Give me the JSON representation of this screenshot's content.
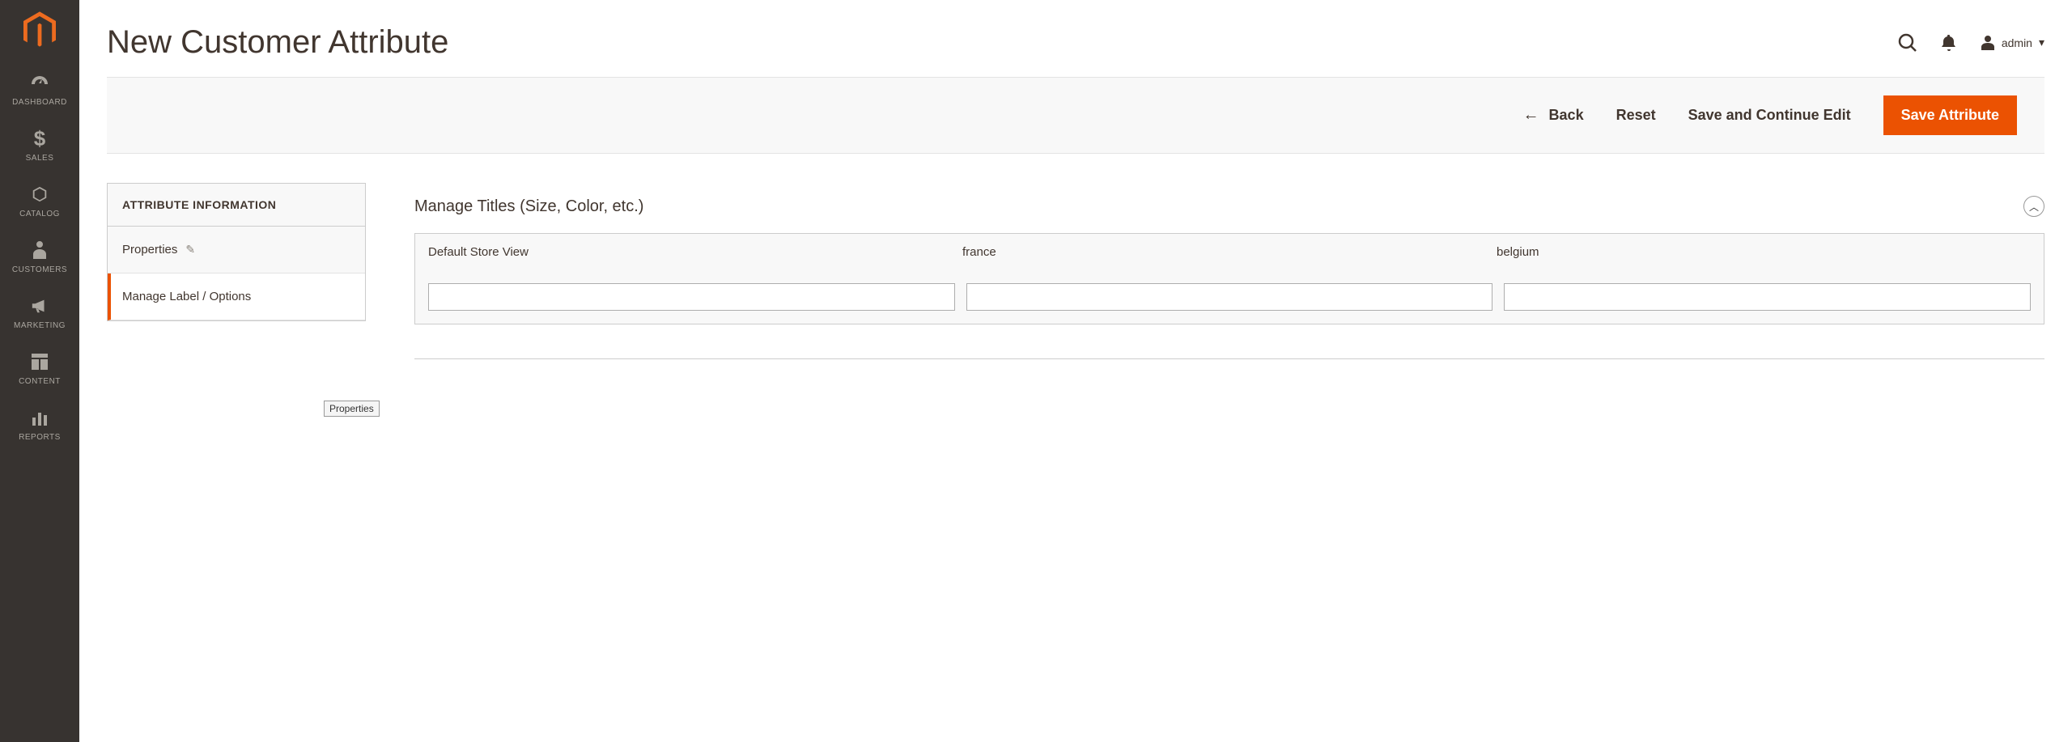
{
  "sidebar": {
    "items": [
      {
        "label": "DASHBOARD"
      },
      {
        "label": "SALES"
      },
      {
        "label": "CATALOG"
      },
      {
        "label": "CUSTOMERS"
      },
      {
        "label": "MARKETING"
      },
      {
        "label": "CONTENT"
      },
      {
        "label": "REPORTS"
      }
    ]
  },
  "header": {
    "title": "New Customer Attribute",
    "user_label": "admin"
  },
  "actions": {
    "back": "Back",
    "reset": "Reset",
    "save_continue": "Save and Continue Edit",
    "save": "Save Attribute"
  },
  "side_panel": {
    "title": "ATTRIBUTE INFORMATION",
    "tab_properties": "Properties",
    "tab_labels": "Manage Label / Options"
  },
  "tooltip": {
    "properties": "Properties"
  },
  "fieldset": {
    "title": "Manage Titles (Size, Color, etc.)",
    "columns": [
      {
        "label": "Default Store View",
        "value": ""
      },
      {
        "label": "france",
        "value": ""
      },
      {
        "label": "belgium",
        "value": ""
      }
    ]
  }
}
